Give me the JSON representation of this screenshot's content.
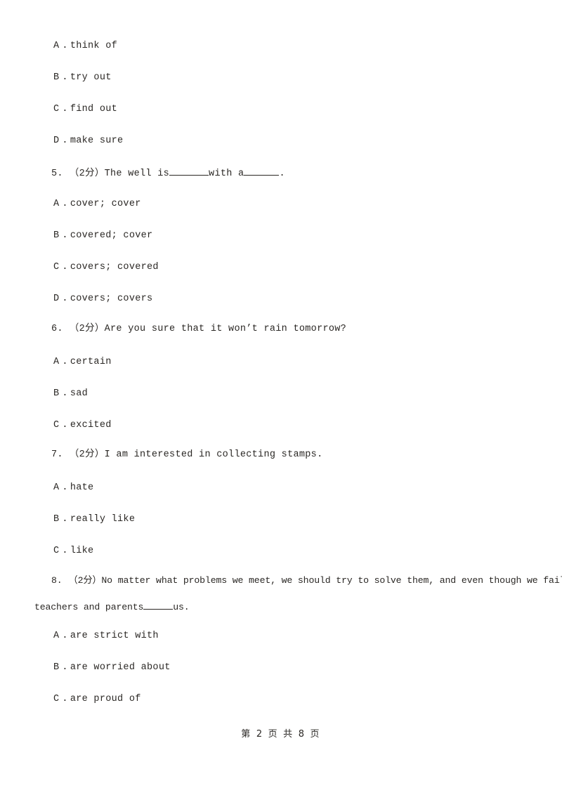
{
  "document": {
    "type": "exam-paper",
    "language": "en-zh",
    "text_color": "#2a2724",
    "background_color": "#ffffff"
  },
  "carryover_options": [
    {
      "label": "A",
      "separator": ".",
      "text": "think of"
    },
    {
      "label": "B",
      "separator": ".",
      "text": "try out"
    },
    {
      "label": "C",
      "separator": ".",
      "text": "find out"
    },
    {
      "label": "D",
      "separator": ".",
      "text": "make sure"
    }
  ],
  "questions": [
    {
      "number": "5.",
      "score": "（2分）",
      "score_value": "2",
      "score_unit": "分",
      "stem_part1": "The well is ",
      "stem_part2": " with a ",
      "stem_part3": ".",
      "options": [
        {
          "label": "A",
          "separator": ".",
          "text": "cover; cover"
        },
        {
          "label": "B",
          "separator": ".",
          "text": "covered; cover"
        },
        {
          "label": "C",
          "separator": ".",
          "text": "covers; covered"
        },
        {
          "label": "D",
          "separator": ".",
          "text": "covers; covers"
        }
      ]
    },
    {
      "number": "6.",
      "score": "（2分）",
      "score_value": "2",
      "score_unit": "分",
      "stem": "Are you sure that it won’t rain tomorrow?",
      "options": [
        {
          "label": "A",
          "separator": ".",
          "text": "certain"
        },
        {
          "label": "B",
          "separator": ".",
          "text": "sad"
        },
        {
          "label": "C",
          "separator": ".",
          "text": "excited"
        }
      ]
    },
    {
      "number": "7.",
      "score": "（2分）",
      "score_value": "2",
      "score_unit": "分",
      "stem": "I am interested in collecting stamps.",
      "options": [
        {
          "label": "A",
          "separator": ".",
          "text": "hate"
        },
        {
          "label": "B",
          "separator": ".",
          "text": "really like"
        },
        {
          "label": "C",
          "separator": ".",
          "text": "like"
        }
      ]
    },
    {
      "number": "8.",
      "score": "（2分）",
      "score_value": "2",
      "score_unit": "分",
      "stem_line1": "No matter what problems we meet, we should try to solve them, and even though we fail,",
      "stem_line2_part1": "teachers and parents ",
      "stem_line2_part2": "us.",
      "options": [
        {
          "label": "A",
          "separator": ".",
          "text": "are strict with"
        },
        {
          "label": "B",
          "separator": ".",
          "text": "are worried about"
        },
        {
          "label": "C",
          "separator": ".",
          "text": "are proud of"
        }
      ]
    }
  ],
  "footer": {
    "text": "第 2 页 共 8 页",
    "current_page": "2",
    "total_pages": "8"
  }
}
